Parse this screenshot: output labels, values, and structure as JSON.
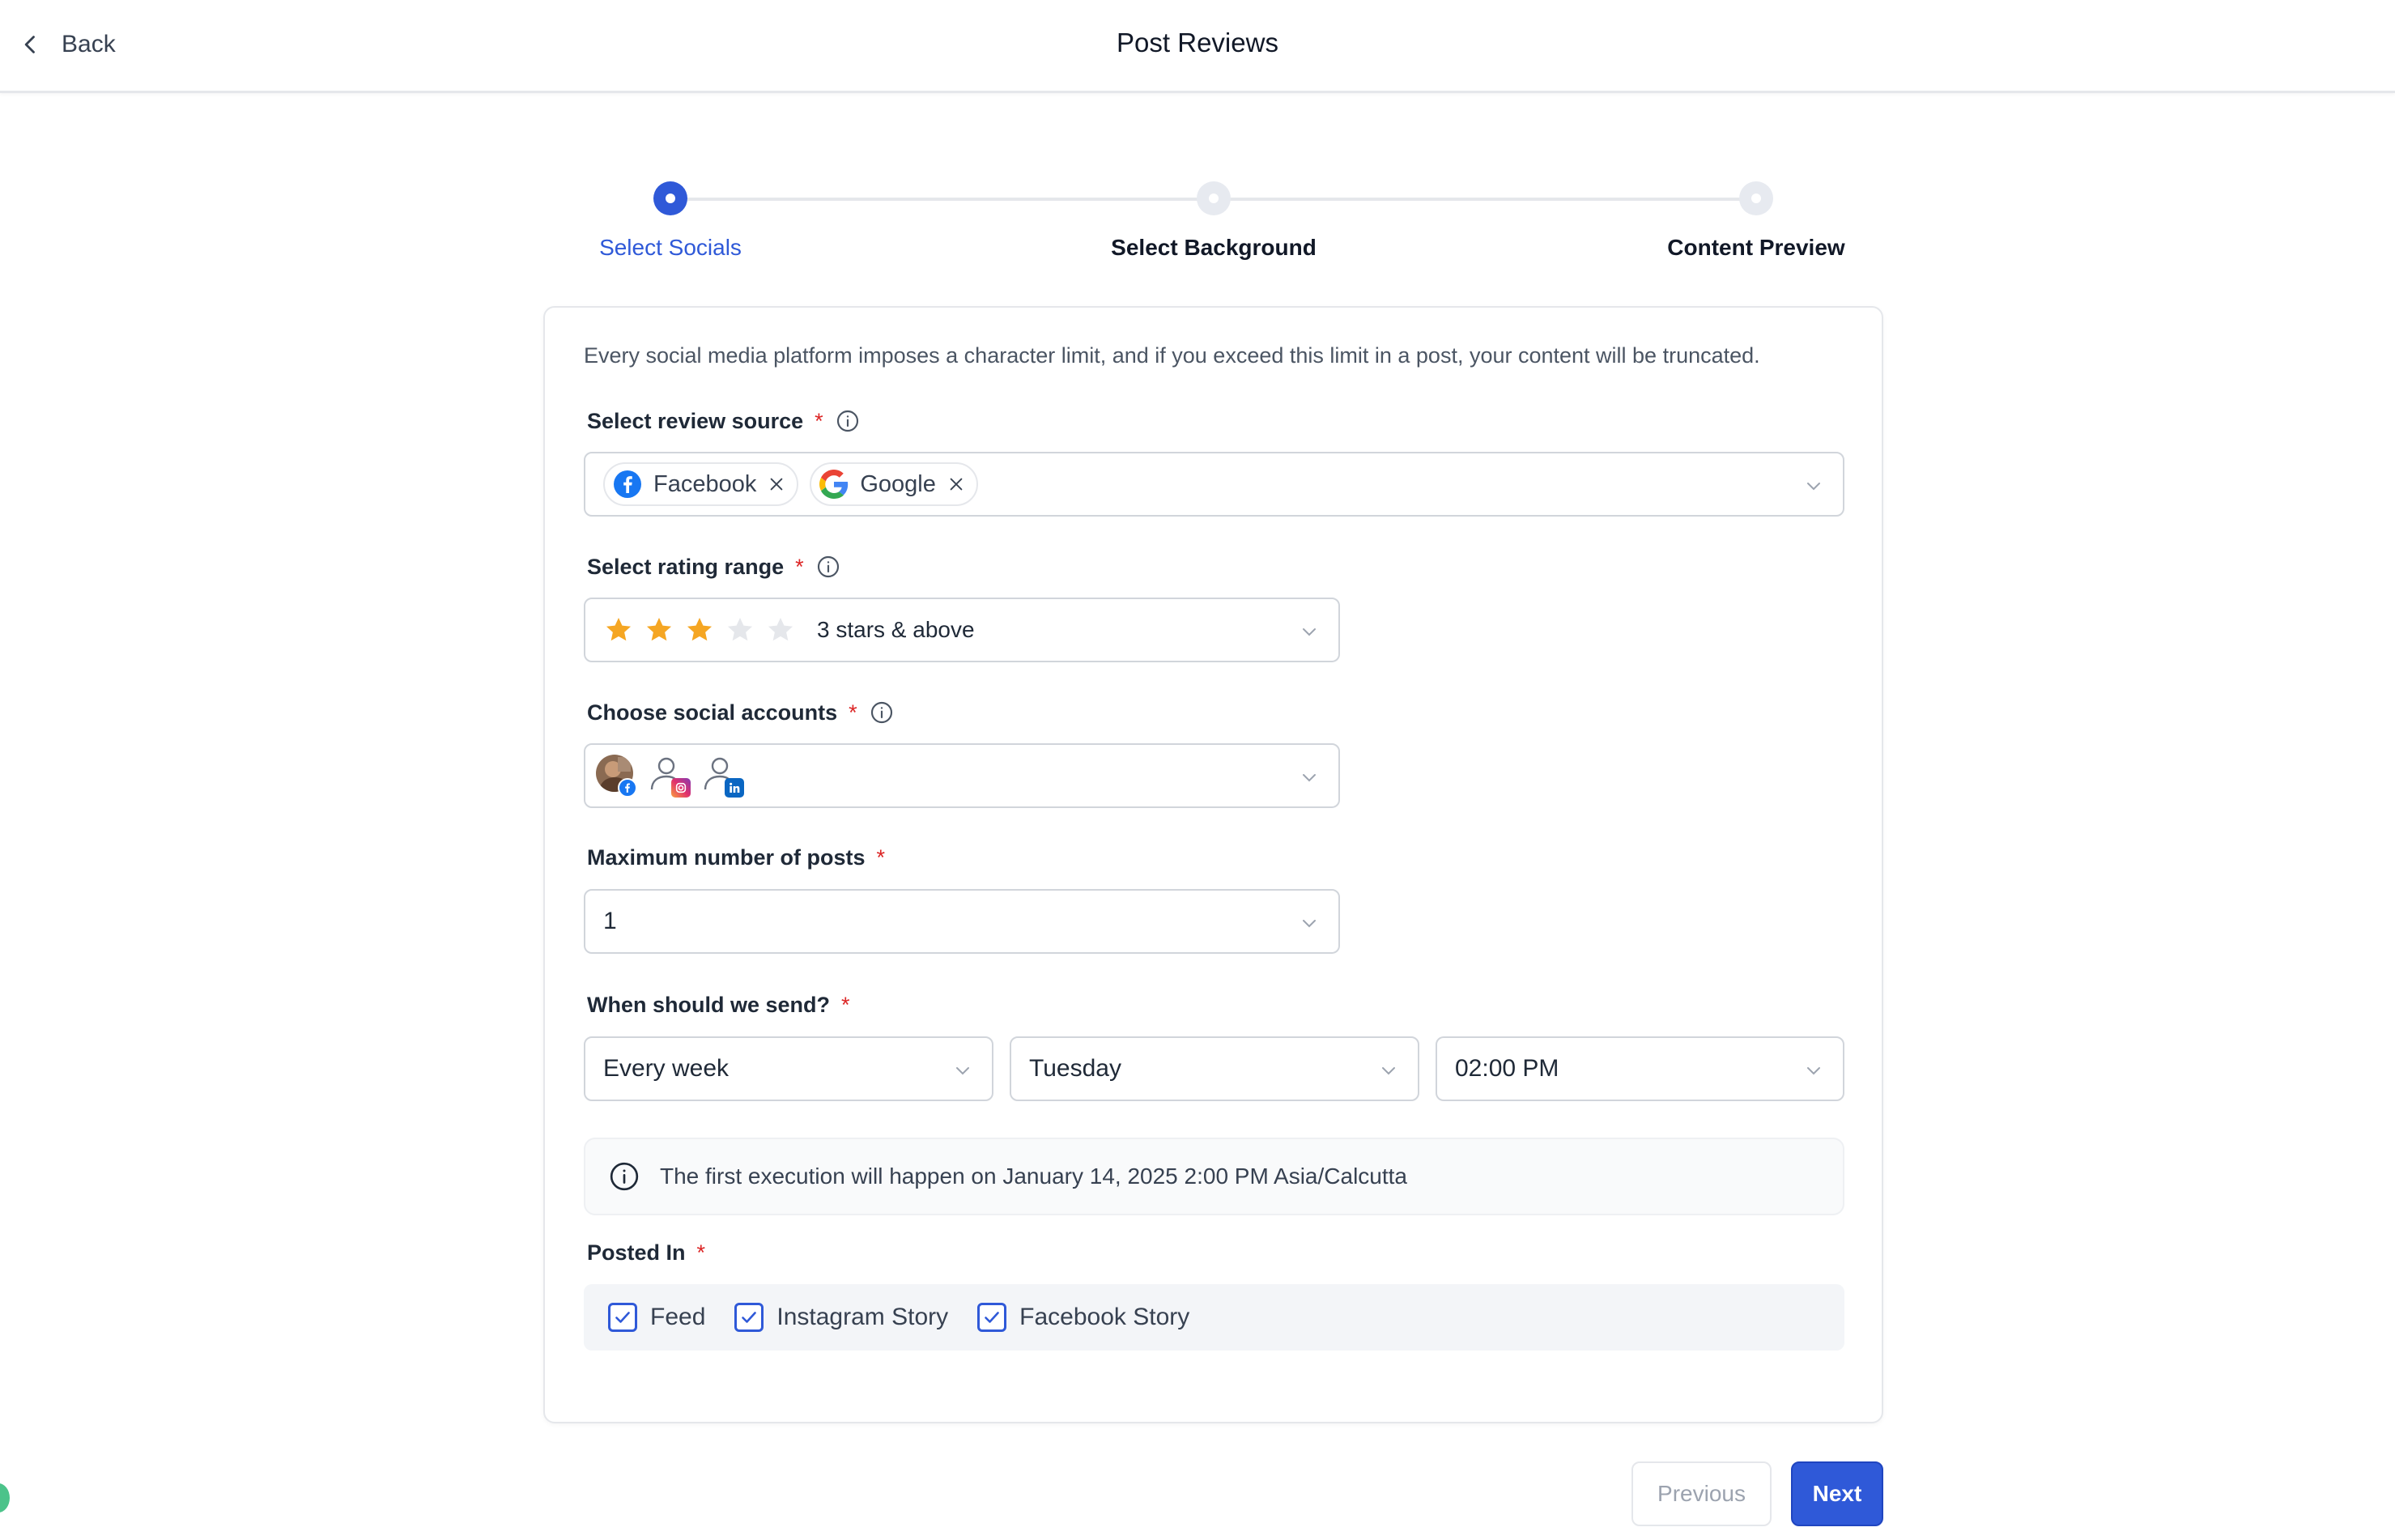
{
  "header": {
    "back_label": "Back",
    "title": "Post Reviews"
  },
  "stepper": {
    "steps": [
      {
        "label": "Select Socials",
        "state": "active"
      },
      {
        "label": "Select Background",
        "state": "idle"
      },
      {
        "label": "Content Preview",
        "state": "idle"
      }
    ]
  },
  "intro_text": "Every social media platform imposes a character limit, and if you exceed this limit in a post, your content will be truncated.",
  "review_source": {
    "label": "Select review source",
    "required_mark": "*",
    "chips": [
      {
        "label": "Facebook",
        "icon": "facebook-icon"
      },
      {
        "label": "Google",
        "icon": "google-icon"
      }
    ]
  },
  "rating_range": {
    "label": "Select rating range",
    "required_mark": "*",
    "stars_filled": 3,
    "stars_total": 5,
    "value": "3 stars & above"
  },
  "social_accounts": {
    "label": "Choose social accounts",
    "required_mark": "*",
    "accounts": [
      {
        "icon": "profile-photo-avatar",
        "badge": "facebook-icon"
      },
      {
        "icon": "user-icon",
        "badge": "instagram-icon"
      },
      {
        "icon": "user-icon",
        "badge": "linkedin-icon"
      }
    ]
  },
  "max_posts": {
    "label": "Maximum number of posts",
    "required_mark": "*",
    "value": "1"
  },
  "schedule": {
    "label": "When should we send?",
    "required_mark": "*",
    "frequency": "Every week",
    "day": "Tuesday",
    "time": "02:00 PM"
  },
  "notice_text": "The first execution will happen on January 14, 2025 2:00 PM Asia/Calcutta",
  "posted_in": {
    "label": "Posted In",
    "required_mark": "*",
    "options": [
      {
        "label": "Feed",
        "checked": true
      },
      {
        "label": "Instagram Story",
        "checked": true
      },
      {
        "label": "Facebook Story",
        "checked": true
      }
    ]
  },
  "buttons": {
    "previous": "Previous",
    "next": "Next"
  },
  "colors": {
    "accent": "#2f59d8",
    "required": "#dc2626",
    "star_filled": "#f5a623",
    "star_empty": "#e5e7eb"
  }
}
